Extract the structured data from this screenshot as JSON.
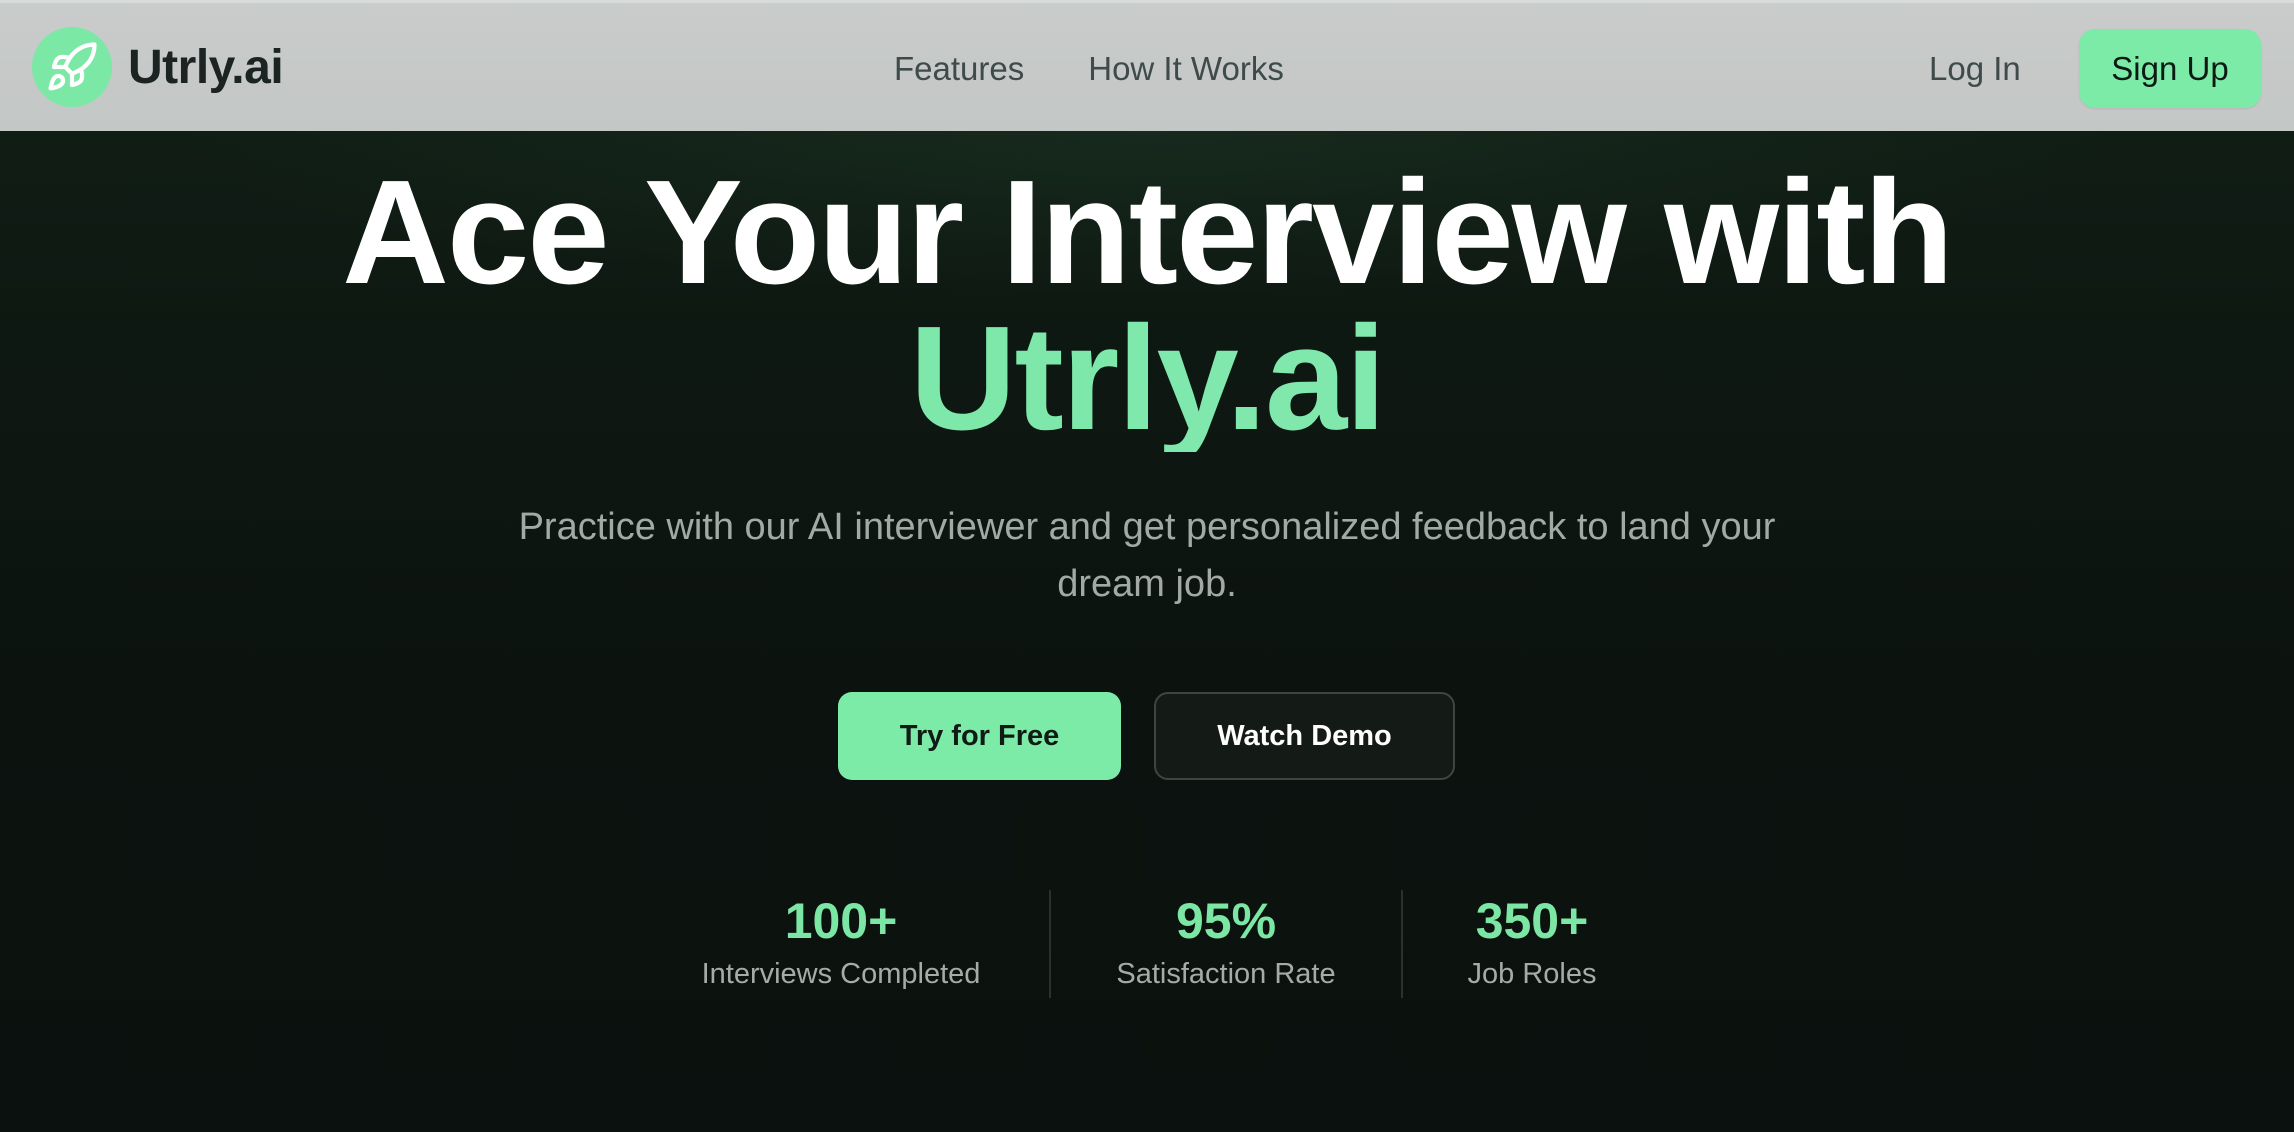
{
  "nav": {
    "brand": "Utrly.ai",
    "links": [
      {
        "label": "Features"
      },
      {
        "label": "How It Works"
      }
    ],
    "login": "Log In",
    "signup": "Sign Up"
  },
  "hero": {
    "title_line1": "Ace Your Interview with",
    "title_accent": "Utrly.ai",
    "subtitle": "Practice with our AI interviewer and get personalized feedback to land your dream job.",
    "cta_primary": "Try for Free",
    "cta_secondary": "Watch Demo"
  },
  "stats": [
    {
      "value": "100+",
      "label": "Interviews Completed"
    },
    {
      "value": "95%",
      "label": "Satisfaction Rate"
    },
    {
      "value": "350+",
      "label": "Job Roles"
    }
  ],
  "icons": {
    "logo": "rocket-icon"
  },
  "colors": {
    "accent": "#7ceba8",
    "background": "#0c130f",
    "nav_background": "#c6c9c8",
    "text_primary": "#ffffff",
    "text_muted": "#a2aaa7"
  }
}
